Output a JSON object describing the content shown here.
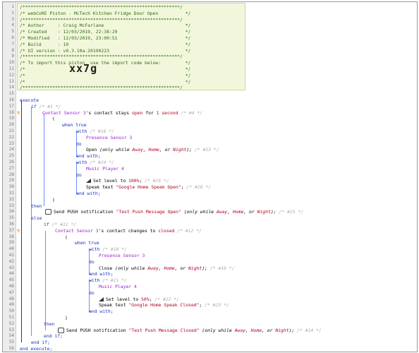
{
  "header": [
    "/**********************************************************/",
    "/* webCoRE Piston - McTech Kitchen Fridge Door Open          */",
    "/**********************************************************/",
    "/* Author     : Craig McFarlane                              */",
    "/* Created    : 12/03/2019, 22:38:29                         */",
    "/* Modified   : 12/03/2019, 23:09:51                         */",
    "/* Build      : 10                                           */",
    "/* UI version : v0.3.10a.20190223                            */",
    "/**********************************************************/",
    "/* To import this piston, use the import code below:         */",
    "/*                                                           */",
    "/*                                                           */",
    "/*                                                           */",
    "/**********************************************************/"
  ],
  "import_code": "xx7g",
  "line_numbers": [
    "1",
    "2",
    "3",
    "4",
    "5",
    "6",
    "7",
    "8",
    "9",
    "10",
    "11",
    "12",
    "13",
    "14",
    "15",
    "16",
    "17",
    "18",
    "19",
    "20",
    "21",
    "22",
    "23",
    "24",
    "25",
    "26",
    "27",
    "28",
    "29",
    "30",
    "31",
    "32",
    "33",
    "34",
    "35",
    "36",
    "37",
    "38",
    "39",
    "40",
    "41",
    "42",
    "43",
    "44",
    "45",
    "46",
    "47",
    "48",
    "49",
    "50",
    "51",
    "52",
    "53",
    "54",
    "55",
    "56"
  ],
  "code": {
    "execute": "execute",
    "if1": "if",
    "if1_id": "/* #1 */",
    "cond1_device": "Contact Sensor 3",
    "cond1_attr": "'s contact stays ",
    "cond1_val": "open",
    "cond1_for": " for ",
    "cond1_dur": "1 second",
    "cond1_id": "/* #4 */",
    "brace_open": "(",
    "brace_close": ")",
    "when_true": "when true",
    "with": "with",
    "with1_id": "/* #16 */",
    "presence": "Presence Sensor 3",
    "do": "do",
    "open_stmt": "Open",
    "only_while_open": "(only while ",
    "away": "Away",
    "home": "Home",
    "night": "Night",
    "or": ", or ",
    "comma": ", ",
    "close_paren": ");",
    "id13": "/* #13 */",
    "end_with": "end with;",
    "with2_id": "/* #24 */",
    "player": "Music Player 4",
    "set_level": "Set level to ",
    "lvl100": "100%",
    "id25": "/* #25 */",
    "speak": "Speak text ",
    "speak_open": "\"Google Home Speak Open\"",
    "id26": "/* #26 */",
    "then": "then",
    "push": "Send PUSH notification ",
    "push_open": "\"Test Push Message Open\"",
    "id15": "/* #15 */",
    "else": "else",
    "if2_id": "/* #11 */",
    "cond2_attr": "'s contact changes to ",
    "cond2_val": "closed",
    "id12": "/* #12 */",
    "with3_id": "/* #18 */",
    "close_stmt": "Close",
    "id19": "/* #19 */",
    "with4_id": "/* #21 */",
    "lvl50": "50%",
    "id22": "/* #22 */",
    "speak_closed": "\"Google Home Speak Closed\"",
    "id23": "/* #23 */",
    "push_closed": "\"Test Push Message Closed\"",
    "id14": "/* #14 */",
    "end_if": "end if;",
    "end_execute": "end execute;",
    "semi": ";"
  },
  "colors": {
    "comment": "#2f6b14",
    "keyword": "#1a2fbd",
    "device": "#9b1fd1",
    "value": "#b00020",
    "bolt": "#e07800"
  },
  "icons": [
    "bolt-icon",
    "message-icon",
    "volume-icon"
  ]
}
